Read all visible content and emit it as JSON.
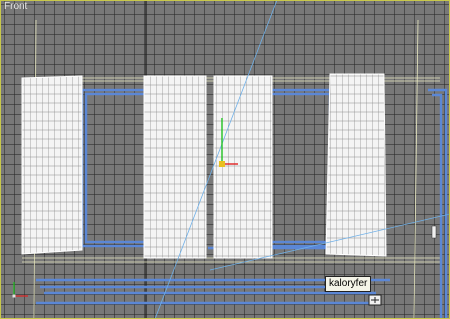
{
  "viewport": {
    "label": "Front",
    "tooltip": "kaloryfer"
  },
  "colors": {
    "background": "#787878",
    "grid": "#4a4a4a",
    "wire": "#ffffff",
    "selection_blue": "#5b87d6",
    "guide_yellow": "#e8e8a0",
    "axis_y": "#20c020",
    "axis_x": "#e02020"
  },
  "icons": {
    "world_axis": "world-axis-icon",
    "cursor": "cursor-icon",
    "transform_gizmo": "transform-gizmo-icon"
  }
}
